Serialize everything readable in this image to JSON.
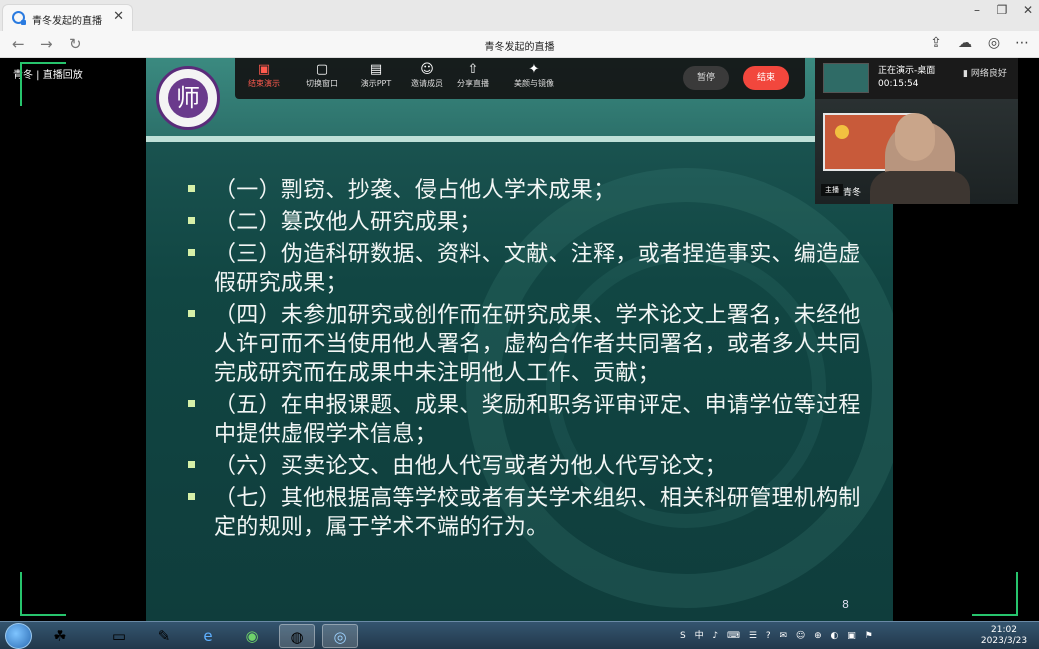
{
  "browser": {
    "tab_title": "青冬发起的直播",
    "page_title": "青冬发起的直播",
    "controls": {
      "minimize": "–",
      "restore": "❐",
      "close": "✕"
    }
  },
  "live": {
    "host_label": "青冬  |  直播回放",
    "toolbar": [
      {
        "label": "结束演示",
        "icon": "stop-present-icon",
        "active": true
      },
      {
        "label": "切换窗口",
        "icon": "switch-window-icon",
        "active": false
      },
      {
        "label": "演示PPT",
        "icon": "ppt-icon",
        "active": false
      },
      {
        "label": "邀请成员",
        "icon": "invite-icon",
        "active": false
      },
      {
        "label": "分享直播",
        "icon": "share-icon",
        "active": false
      },
      {
        "label": "美颜与镜像",
        "icon": "beauty-icon",
        "active": false
      }
    ],
    "pause_label": "暂停",
    "end_label": "结束",
    "status": "正在演示-桌面",
    "duration": "00:15:54",
    "network": "网络良好",
    "camera_tag": "主播",
    "camera_name": "青冬"
  },
  "slide": {
    "logo_char": "师",
    "bullets": [
      "（一）剽窃、抄袭、侵占他人学术成果；",
      "（二）篡改他人研究成果；",
      "（三）伪造科研数据、资料、文献、注释，或者捏造事实、编造虚假研究成果；",
      "（四）未参加研究或创作而在研究成果、学术论文上署名，未经他人许可而不当使用他人署名，虚构合作者共同署名，或者多人共同完成研究而在成果中未注明他人工作、贡献；",
      "（五）在申报课题、成果、奖励和职务评审评定、申请学位等过程中提供虚假学术信息；",
      "（六）买卖论文、由他人代写或者为他人代写论文；",
      "（七）其他根据高等学校或者有关学术组织、相关科研管理机构制定的规则，属于学术不端的行为。"
    ],
    "page_number": "8"
  },
  "taskbar": {
    "time": "21:02",
    "date": "2023/3/23",
    "tray": "S 中 ♪ ⌨ ☰ ? ✉ ☺ ⊕ ◐ ▣ ⚑"
  }
}
